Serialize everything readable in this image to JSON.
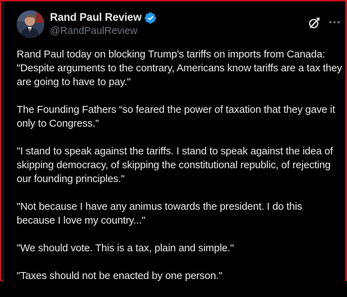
{
  "author": {
    "display_name": "Rand Paul Review",
    "handle": "@RandPaulReview",
    "verified_icon": "verified-badge-icon",
    "avatar": "avatar-photo"
  },
  "header_icons": {
    "grok": "grok-icon",
    "more": "more-options-icon"
  },
  "post": {
    "paragraphs": [
      "Rand Paul today on blocking Trump's tariffs on imports from Canada: \"Despite arguments to the contrary, Americans know tariffs are a tax they are going to have to pay.\"",
      "The Founding Fathers “so feared the power of taxation that they gave it only to Congress.”",
      "\"I stand to speak against the tariffs. I stand to speak against the idea of skipping democracy, of skipping the constitutional republic, of rejecting our founding principles.\"",
      "\"Not because I have any animus towards the president. I do this because I love my country...\"",
      "\"We should vote. This is a tax, plain and simple.\"",
      "\"Taxes should not be enacted by one person.\""
    ]
  },
  "colors": {
    "background": "#000000",
    "text_primary": "#e7e9ea",
    "text_secondary": "#71767b",
    "verified_blue": "#1d9bf0",
    "frame_red": "#c8101e"
  }
}
